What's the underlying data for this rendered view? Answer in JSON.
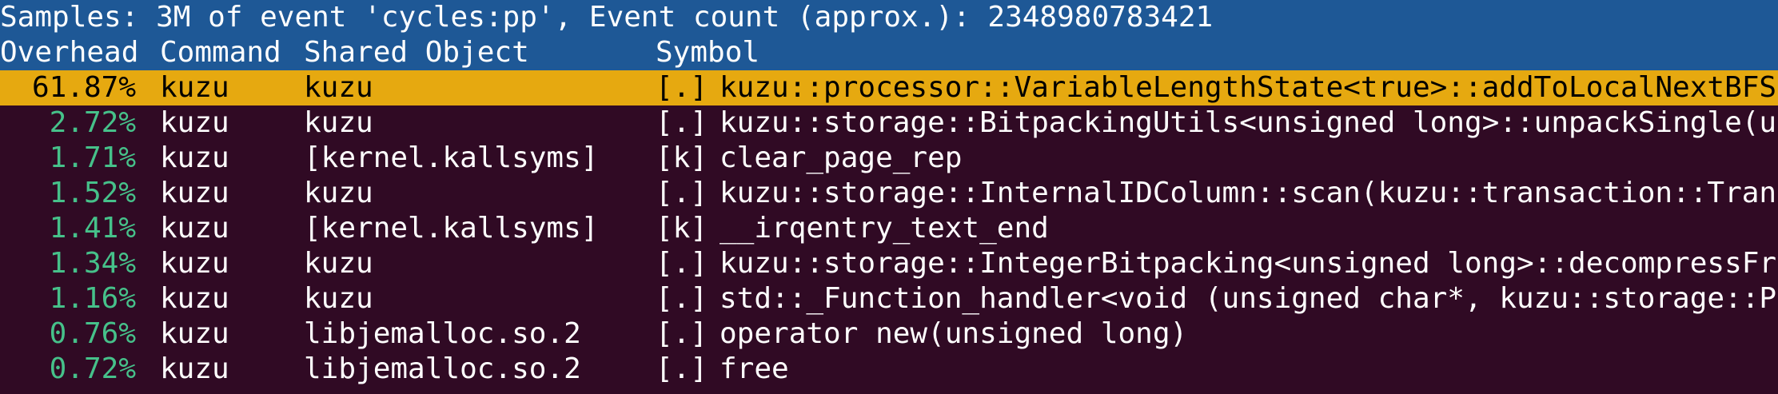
{
  "title": "Samples: 3M of event 'cycles:pp', Event count (approx.): 2348980783421",
  "columns": {
    "overhead": "Overhead",
    "command": "Command",
    "shared_object": "Shared Object",
    "symbol": "Symbol"
  },
  "rows": [
    {
      "overhead": "61.87%",
      "command": "kuzu",
      "shared_object": "kuzu",
      "level": "[.]",
      "symbol": "kuzu::processor::VariableLengthState<true>::addToLocalNextBFSLevel",
      "selected": true
    },
    {
      "overhead": "2.72%",
      "command": "kuzu",
      "shared_object": "kuzu",
      "level": "[.]",
      "symbol": "kuzu::storage::BitpackingUtils<unsigned long>::unpackSingle(unsigne"
    },
    {
      "overhead": "1.71%",
      "command": "kuzu",
      "shared_object": "[kernel.kallsyms]",
      "level": "[k]",
      "symbol": "clear_page_rep"
    },
    {
      "overhead": "1.52%",
      "command": "kuzu",
      "shared_object": "kuzu",
      "level": "[.]",
      "symbol": "kuzu::storage::InternalIDColumn::scan(kuzu::transaction::Transactio"
    },
    {
      "overhead": "1.41%",
      "command": "kuzu",
      "shared_object": "[kernel.kallsyms]",
      "level": "[k]",
      "symbol": "__irqentry_text_end"
    },
    {
      "overhead": "1.34%",
      "command": "kuzu",
      "shared_object": "kuzu",
      "level": "[.]",
      "symbol": "kuzu::storage::IntegerBitpacking<unsigned long>::decompressFromPage"
    },
    {
      "overhead": "1.16%",
      "command": "kuzu",
      "shared_object": "kuzu",
      "level": "[.]",
      "symbol": "std::_Function_handler<void (unsigned char*, kuzu::storage::PageCur"
    },
    {
      "overhead": "0.76%",
      "command": "kuzu",
      "shared_object": "libjemalloc.so.2",
      "level": "[.]",
      "symbol": "operator new(unsigned long)"
    },
    {
      "overhead": "0.72%",
      "command": "kuzu",
      "shared_object": "libjemalloc.so.2",
      "level": "[.]",
      "symbol": "free"
    }
  ],
  "colors": {
    "background": "#300a24",
    "header_bar": "#1e5896",
    "selected_row": "#e6a910",
    "overhead_text": "#46c18a"
  }
}
